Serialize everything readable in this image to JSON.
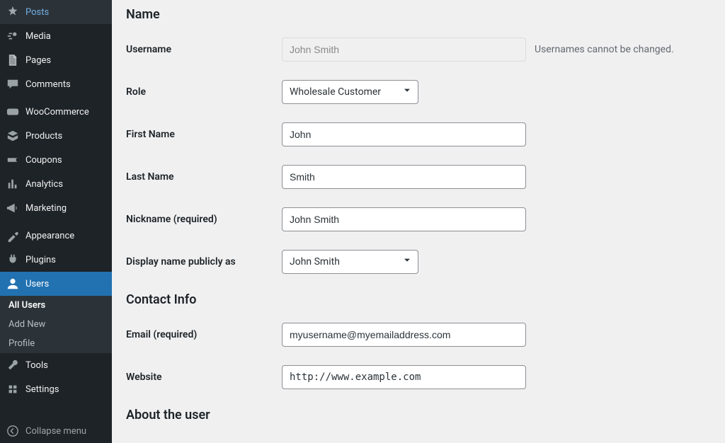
{
  "nav": {
    "items": [
      {
        "id": "posts",
        "label": "Posts",
        "icon": "pin"
      },
      {
        "id": "media",
        "label": "Media",
        "icon": "media"
      },
      {
        "id": "pages",
        "label": "Pages",
        "icon": "pages"
      },
      {
        "id": "comments",
        "label": "Comments",
        "icon": "comments"
      }
    ],
    "items2": [
      {
        "id": "woocommerce",
        "label": "WooCommerce",
        "icon": "woo"
      },
      {
        "id": "products",
        "label": "Products",
        "icon": "products"
      },
      {
        "id": "coupons",
        "label": "Coupons",
        "icon": "coupons"
      },
      {
        "id": "analytics",
        "label": "Analytics",
        "icon": "analytics"
      },
      {
        "id": "marketing",
        "label": "Marketing",
        "icon": "marketing"
      }
    ],
    "items3": [
      {
        "id": "appearance",
        "label": "Appearance",
        "icon": "appearance"
      },
      {
        "id": "plugins",
        "label": "Plugins",
        "icon": "plugins"
      }
    ],
    "active": {
      "id": "users",
      "label": "Users",
      "icon": "users"
    },
    "submenu": {
      "allUsers": "All Users",
      "addNew": "Add New",
      "profile": "Profile"
    },
    "items4": [
      {
        "id": "tools",
        "label": "Tools",
        "icon": "tools"
      },
      {
        "id": "settings",
        "label": "Settings",
        "icon": "settings"
      }
    ],
    "collapse": "Collapse menu"
  },
  "sections": {
    "name": "Name",
    "contact": "Contact Info",
    "about": "About the user"
  },
  "labels": {
    "username": "Username",
    "role": "Role",
    "firstName": "First Name",
    "lastName": "Last Name",
    "nickname": "Nickname",
    "required": "(required)",
    "displayName": "Display name publicly as",
    "email": "Email",
    "website": "Website"
  },
  "values": {
    "username": "John Smith",
    "usernameNote": "Usernames cannot be changed.",
    "role": "Wholesale Customer",
    "firstName": "John",
    "lastName": "Smith",
    "nickname": "John Smith",
    "displayName": "John Smith",
    "email": "myusername@myemailaddress.com",
    "website": "http://www.example.com"
  }
}
